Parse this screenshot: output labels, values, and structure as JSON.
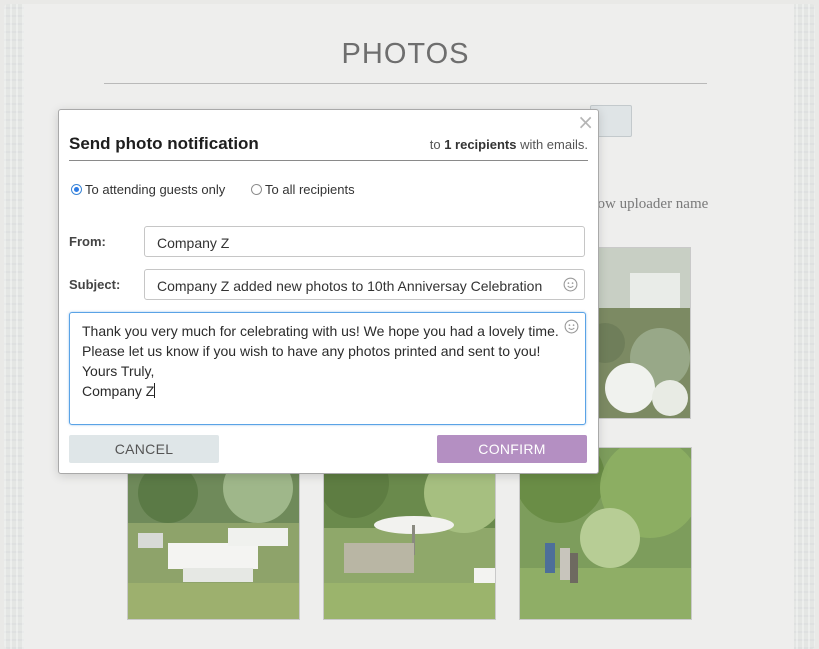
{
  "page": {
    "title": "PHOTOS",
    "uploader_text": "how uploader name"
  },
  "dialog": {
    "title": "Send photo notification",
    "recipients": {
      "prefix": "to",
      "count_text": "1 recipients",
      "suffix": "with emails."
    },
    "audience_options": [
      {
        "label": "To attending guests only",
        "selected": true
      },
      {
        "label": "To all recipients",
        "selected": false
      }
    ],
    "from_label": "From:",
    "from_value": "Company Z",
    "subject_label": "Subject:",
    "subject_value": "Company Z added new photos to 10th Anniversay Celebration",
    "message_lines": [
      "Thank you very much for celebrating with us! We hope you had a lovely time.",
      "Please let us know if you wish to have any photos printed and sent to you!",
      "Yours Truly,",
      "Company Z"
    ],
    "cancel_label": "CANCEL",
    "confirm_label": "CONFIRM",
    "close_glyph": "×"
  },
  "colors": {
    "accent_confirm": "#b48fc2",
    "radio_selected": "#2c7be5",
    "focus_border": "#5aa3e6"
  }
}
